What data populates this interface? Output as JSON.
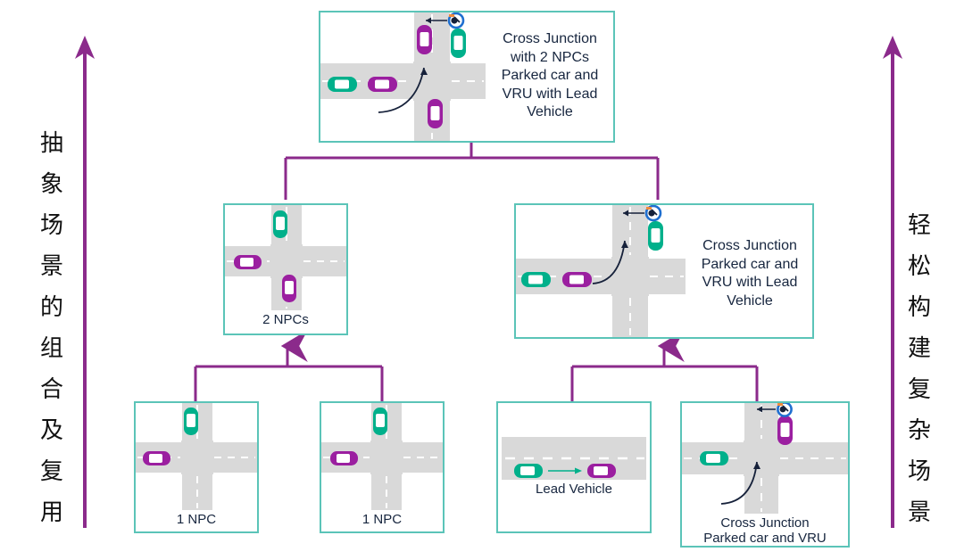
{
  "diagram": {
    "title": "Scenario composition hierarchy",
    "colors": {
      "box_border": "#5bc4b8",
      "connector": "#8b2a8b",
      "text": "#17263f",
      "road": "#d9d9d9",
      "car_green": "#00b08b",
      "car_purple": "#9b1fa0",
      "vru_blue": "#1f6fd0",
      "vru_orange": "#f08a3c",
      "lane_marking": "#ffffff"
    }
  },
  "side_labels": {
    "left": {
      "text": "抽象场景的组合及复用",
      "chars": [
        "抽",
        "象",
        "场",
        "景",
        "的",
        "组",
        "合",
        "及",
        "复",
        "用"
      ],
      "arrow": "up-arrow"
    },
    "right": {
      "text": "轻松构建复杂场景",
      "chars": [
        "轻",
        "松",
        "构",
        "建",
        "复",
        "杂",
        "场",
        "景"
      ],
      "arrow": "up-arrow"
    }
  },
  "nodes": {
    "root": {
      "id": "cross-junction-2npcs-parked-vru-lead",
      "description": "Cross Junction\nwith 2 NPCs\nParked car and\nVRU with Lead\nVehicle",
      "scene_type": "cross-junction",
      "actors": [
        "green-car-north-parked",
        "purple-car-north",
        "purple-car-south",
        "green-car-west-lead",
        "purple-car-west",
        "vru-cyclist"
      ]
    },
    "level2_left": {
      "id": "2-npcs",
      "caption": "2 NPCs",
      "scene_type": "cross-junction",
      "actors": [
        "green-car-north",
        "purple-car-west",
        "purple-car-south"
      ]
    },
    "level2_right": {
      "id": "cross-junction-parked-vru-lead",
      "description": "Cross Junction\nParked car and\nVRU with Lead\nVehicle",
      "scene_type": "cross-junction",
      "actors": [
        "green-car-north-parked",
        "green-car-west-lead",
        "purple-car-west",
        "vru-cyclist"
      ]
    },
    "leaf1": {
      "id": "1-npc-a",
      "caption": "1 NPC",
      "scene_type": "cross-junction",
      "actors": [
        "green-car-north",
        "purple-car-west"
      ]
    },
    "leaf2": {
      "id": "1-npc-b",
      "caption": "1 NPC",
      "scene_type": "cross-junction",
      "actors": [
        "green-car-north",
        "purple-car-west"
      ]
    },
    "leaf3": {
      "id": "lead-vehicle",
      "caption": "Lead Vehicle",
      "scene_type": "straight-road",
      "actors": [
        "green-car-ego",
        "purple-car-lead"
      ]
    },
    "leaf4": {
      "id": "cross-junction-parked-car-vru",
      "caption": "Cross Junction\nParked car and VRU",
      "scene_type": "cross-junction",
      "actors": [
        "purple-car-north-parked",
        "green-car-west",
        "vru-cyclist"
      ]
    }
  },
  "connectors": [
    {
      "name": "root-to-level2",
      "from": "root",
      "to": [
        "level2_left",
        "level2_right"
      ]
    },
    {
      "name": "leaves-to-level2-left",
      "from": [
        "leaf1",
        "leaf2"
      ],
      "to": "level2_left",
      "arrow": "up"
    },
    {
      "name": "leaves-to-level2-right",
      "from": [
        "leaf3",
        "leaf4"
      ],
      "to": "level2_right",
      "arrow": "up"
    }
  ]
}
